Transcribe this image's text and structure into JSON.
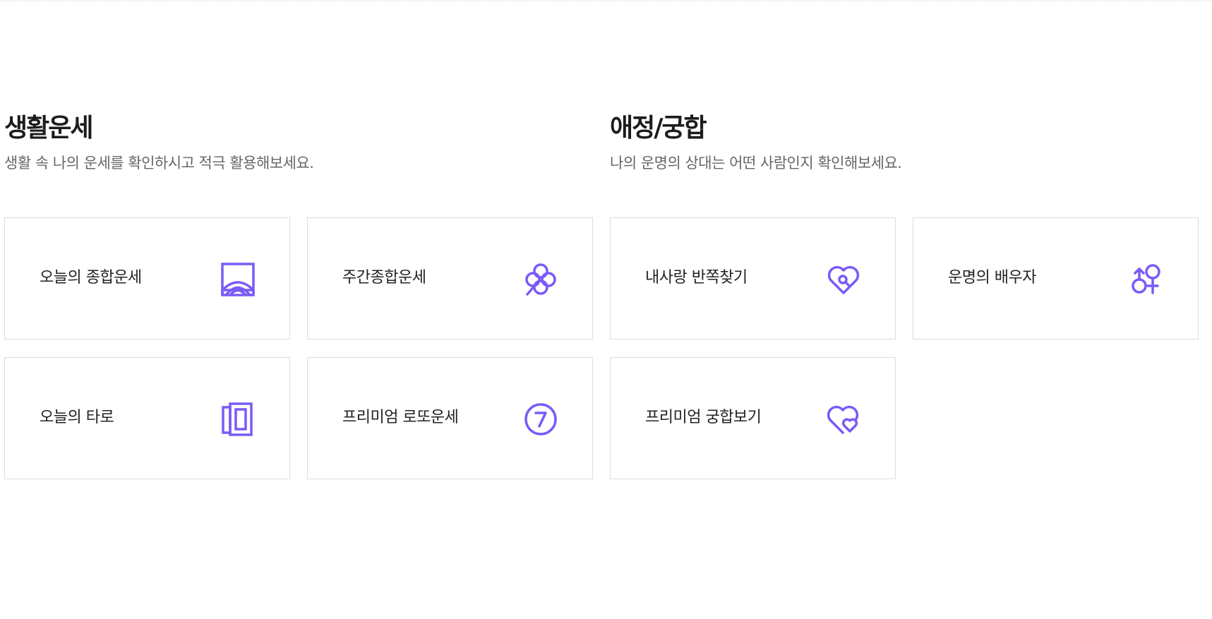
{
  "accent_color": "#7a5af8",
  "sections": [
    {
      "title": "생활운세",
      "description": "생활 속 나의 운세를 확인하시고 적극 활용해보세요.",
      "cards": [
        {
          "label": "오늘의 종합운세",
          "icon": "sunrise-frame-icon"
        },
        {
          "label": "주간종합운세",
          "icon": "clover-icon"
        },
        {
          "label": "오늘의 타로",
          "icon": "tarot-cards-icon"
        },
        {
          "label": "프리미엄 로또운세",
          "icon": "number-seven-icon"
        }
      ]
    },
    {
      "title": "애정/궁합",
      "description": "나의 운명의 상대는 어떤 사람인지 확인해보세요.",
      "cards": [
        {
          "label": "내사랑 반쪽찾기",
          "icon": "heart-search-icon"
        },
        {
          "label": "운명의 배우자",
          "icon": "gender-symbols-icon"
        },
        {
          "label": "프리미엄 궁합보기",
          "icon": "double-heart-icon"
        }
      ]
    }
  ]
}
